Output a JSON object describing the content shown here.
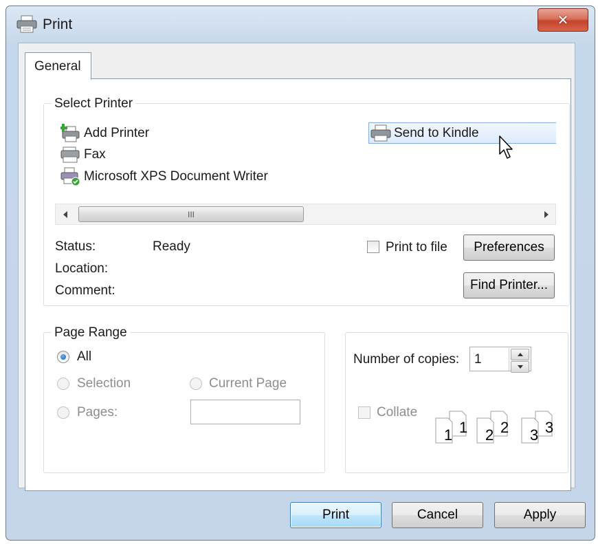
{
  "window": {
    "title": "Print",
    "close_glyph": "✕",
    "title_icon": "printer-icon"
  },
  "tabs": [
    {
      "label": "General",
      "selected": true
    }
  ],
  "select_printer": {
    "group_label": "Select Printer",
    "printers": [
      {
        "name": "Add Printer",
        "icon": "add-printer-icon"
      },
      {
        "name": "Fax",
        "icon": "fax-icon"
      },
      {
        "name": "Microsoft XPS Document Writer",
        "icon": "xps-printer-icon"
      },
      {
        "name": "Send to Kindle",
        "icon": "printer-icon",
        "selected": true
      }
    ],
    "scrollbar_grip": "III",
    "status_label": "Status:",
    "status_value": "Ready",
    "location_label": "Location:",
    "location_value": "",
    "comment_label": "Comment:",
    "comment_value": "",
    "print_to_file_label": "Print to file",
    "print_to_file_checked": false,
    "preferences_label": "Preferences",
    "find_printer_label": "Find Printer..."
  },
  "page_range": {
    "group_label": "Page Range",
    "all_label": "All",
    "selection_label": "Selection",
    "current_page_label": "Current Page",
    "pages_label": "Pages:",
    "pages_value": "",
    "selected_option": "All"
  },
  "copies": {
    "number_label": "Number of copies:",
    "number_value": "1",
    "collate_label": "Collate",
    "collate_checked": false,
    "collate_pages": [
      "1",
      "1",
      "2",
      "2",
      "3",
      "3"
    ]
  },
  "buttons": {
    "print_label": "Print",
    "cancel_label": "Cancel",
    "apply_label": "Apply"
  },
  "colors": {
    "frame": "#c5d7ea",
    "selection_highlight": "#dceafc",
    "close_button": "#c4442b",
    "default_button_border": "#3c7fb1"
  }
}
